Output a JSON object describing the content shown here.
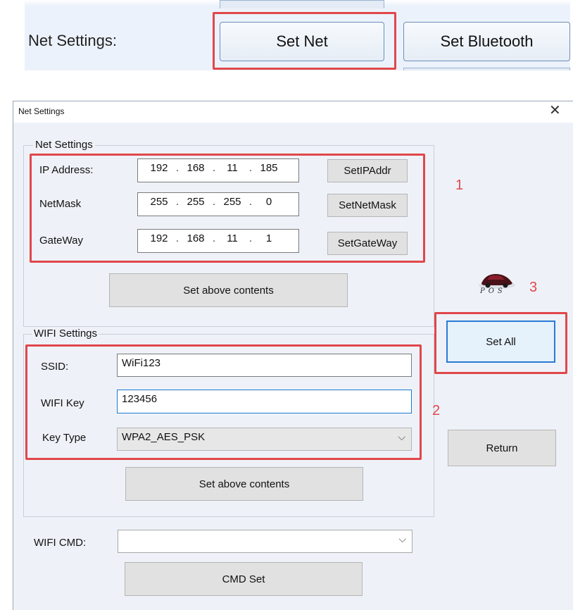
{
  "top_bar": {
    "label": "Net Settings:",
    "set_net_button": "Set Net",
    "set_bluetooth_button": "Set Bluetooth"
  },
  "dialog": {
    "title": "Net Settings",
    "close_glyph": "✕",
    "net_group": {
      "legend": "Net Settings",
      "ip_label": "IP Address:",
      "ip_value": [
        "192",
        "168",
        "11",
        "185"
      ],
      "mask_label": "NetMask",
      "mask_value": [
        "255",
        "255",
        "255",
        "0"
      ],
      "gateway_label": "GateWay",
      "gateway_value": [
        "192",
        "168",
        "11",
        "1"
      ],
      "set_ip_button": "SetIPAddr",
      "set_mask_button": "SetNetMask",
      "set_gateway_button": "SetGateWay",
      "set_contents_button": "Set above contents"
    },
    "wifi_group": {
      "legend": "WIFI Settings",
      "ssid_label": "SSID:",
      "ssid_value": "WiFi123",
      "key_label": "WIFI Key",
      "key_value": "123456",
      "type_label": "Key Type",
      "type_value": "WPA2_AES_PSK",
      "set_contents_button": "Set above contents"
    },
    "cmd_label": "WIFI CMD:",
    "cmd_value": "",
    "cmd_button": "CMD Set",
    "set_all_button": "Set All",
    "return_button": "Return",
    "logo_text": "POS"
  },
  "annotations": {
    "box1_number": "1",
    "box2_number": "2",
    "box3_number": "3",
    "highlight_color": "#e0474c"
  }
}
